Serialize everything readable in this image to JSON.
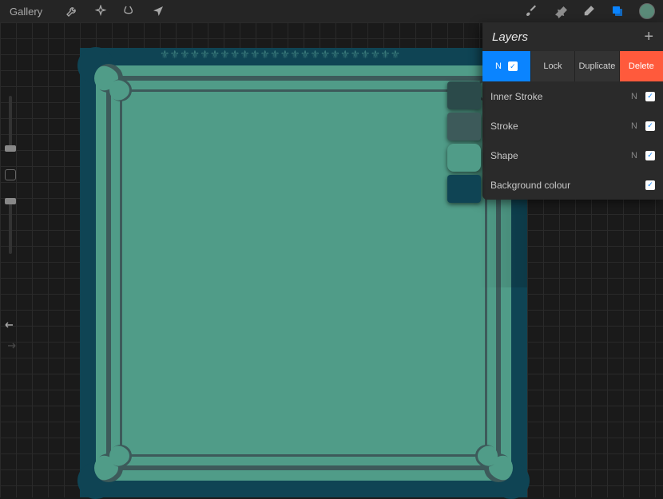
{
  "toolbar": {
    "gallery_label": "Gallery"
  },
  "layers_panel": {
    "title": "Layers",
    "options": {
      "blend_letter": "N",
      "lock": "Lock",
      "duplicate": "Duplicate",
      "delete": "Delete"
    },
    "layers": [
      {
        "name": "Inner Stroke",
        "blend": "N",
        "visible": true
      },
      {
        "name": "Stroke",
        "blend": "N",
        "visible": true
      },
      {
        "name": "Shape",
        "blend": "N",
        "visible": true
      },
      {
        "name": "Background colour",
        "blend": "",
        "visible": true
      }
    ]
  },
  "colors": {
    "accent": "#0a84ff",
    "delete": "#ff5a3c",
    "canvas_bg": "#0f4454",
    "shape": "#509c88",
    "stroke": "#3d5a5a"
  }
}
